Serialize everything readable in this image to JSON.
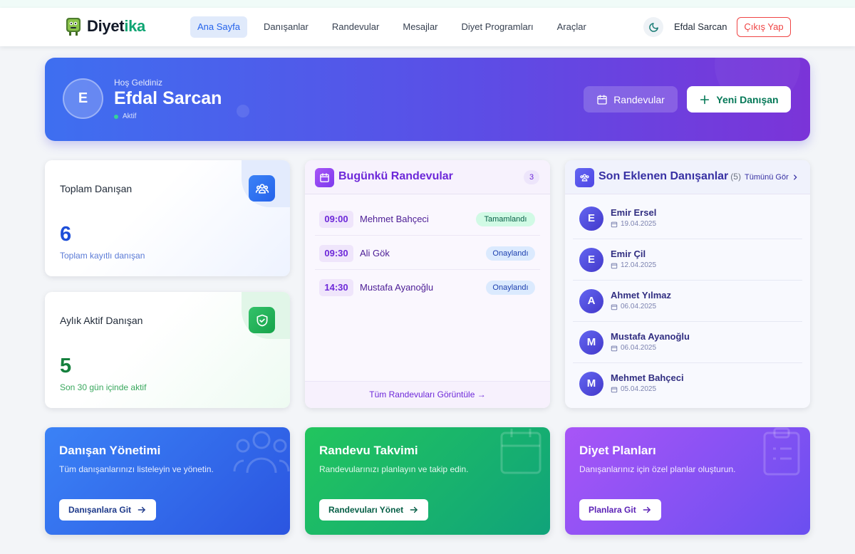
{
  "app": {
    "name_main": "Diyet",
    "name_accent": "ika"
  },
  "nav": {
    "items": [
      {
        "label": "Ana Sayfa",
        "active": true
      },
      {
        "label": "Danışanlar",
        "active": false
      },
      {
        "label": "Randevular",
        "active": false
      },
      {
        "label": "Mesajlar",
        "active": false
      },
      {
        "label": "Diyet Programları",
        "active": false
      },
      {
        "label": "Araçlar",
        "active": false
      }
    ],
    "theme_icon": "moon-icon",
    "user_name": "Efdal Sarcan",
    "logout_label": "Çıkış Yap"
  },
  "hero": {
    "avatar_initial": "E",
    "welcome": "Hoş Geldiniz",
    "name": "Efdal Sarcan",
    "status": "Aktif",
    "appointments_button": "Randevular",
    "new_client_button": "Yeni Danışan"
  },
  "stats": {
    "total": {
      "title": "Toplam Danışan",
      "value": "6",
      "subtitle": "Toplam kayıtlı danışan",
      "icon": "users-icon"
    },
    "active": {
      "title": "Aylık Aktif Danışan",
      "value": "5",
      "subtitle": "Son 30 gün içinde aktif",
      "icon": "shield-check-icon"
    }
  },
  "appointments": {
    "title": "Bugünkü Randevular",
    "count": "3",
    "rows": [
      {
        "time": "09:00",
        "name": "Mehmet Bahçeci",
        "status": "Tamamlandı",
        "status_type": "done"
      },
      {
        "time": "09:30",
        "name": "Ali Gök",
        "status": "Onaylandı",
        "status_type": "ok"
      },
      {
        "time": "14:30",
        "name": "Mustafa Ayanoğlu",
        "status": "Onaylandı",
        "status_type": "ok"
      }
    ],
    "footer_link": "Tüm Randevuları Görüntüle →"
  },
  "recent_clients": {
    "title": "Son Eklenen Danışanlar",
    "count": "(5)",
    "view_all": "Tümünü Gör",
    "rows": [
      {
        "initial": "E",
        "name": "Emir Ersel",
        "date": "19.04.2025"
      },
      {
        "initial": "E",
        "name": "Emir Çil",
        "date": "12.04.2025"
      },
      {
        "initial": "A",
        "name": "Ahmet Yılmaz",
        "date": "06.04.2025"
      },
      {
        "initial": "M",
        "name": "Mustafa Ayanoğlu",
        "date": "06.04.2025"
      },
      {
        "initial": "M",
        "name": "Mehmet Bahçeci",
        "date": "05.04.2025"
      }
    ]
  },
  "actions": [
    {
      "title": "Danışan Yönetimi",
      "description": "Tüm danışanlarınızı listeleyin ve yönetin.",
      "button": "Danışanlara Git",
      "icon": "users-icon"
    },
    {
      "title": "Randevu Takvimi",
      "description": "Randevularınızı planlayın ve takip edin.",
      "button": "Randevuları Yönet",
      "icon": "calendar-icon"
    },
    {
      "title": "Diyet Planları",
      "description": "Danışanlarınız için özel planlar oluşturun.",
      "button": "Planlara Git",
      "icon": "clipboard-icon"
    }
  ],
  "colors": {
    "brand_green": "#0ea573",
    "primary_blue": "#2563eb",
    "purple": "#6d28d9",
    "indigo": "#3730a3",
    "danger": "#ef4444"
  }
}
